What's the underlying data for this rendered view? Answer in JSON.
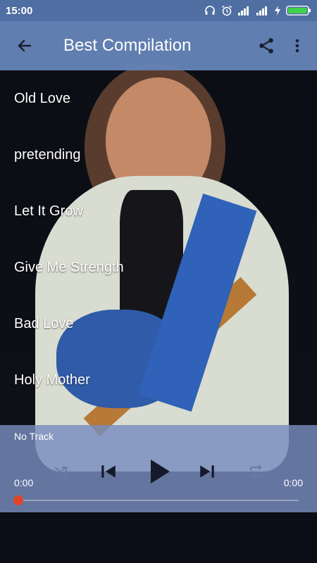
{
  "status_bar": {
    "time": "15:00",
    "icons": [
      "headphones-icon",
      "alarm-icon",
      "signal-icon",
      "signal-icon",
      "charging-icon",
      "battery-icon"
    ]
  },
  "app_bar": {
    "title": "Best Compilation",
    "back_icon": "back-arrow-icon",
    "share_icon": "share-icon",
    "menu_icon": "more-vert-icon"
  },
  "tracks": [
    {
      "title": "Old Love"
    },
    {
      "title": "pretending"
    },
    {
      "title": "Let It Grow"
    },
    {
      "title": "Give Me Strength"
    },
    {
      "title": "Bad Love"
    },
    {
      "title": "Holy Mother"
    }
  ],
  "player": {
    "now_playing": "No Track",
    "elapsed": "0:00",
    "duration": "0:00",
    "progress": 0,
    "controls": [
      "shuffle-icon",
      "previous-icon",
      "play-icon",
      "next-icon",
      "repeat-icon"
    ]
  },
  "colors": {
    "accent": "#e2442b",
    "app_bar": "#6685b8",
    "status_bar": "#4f6ea2"
  }
}
